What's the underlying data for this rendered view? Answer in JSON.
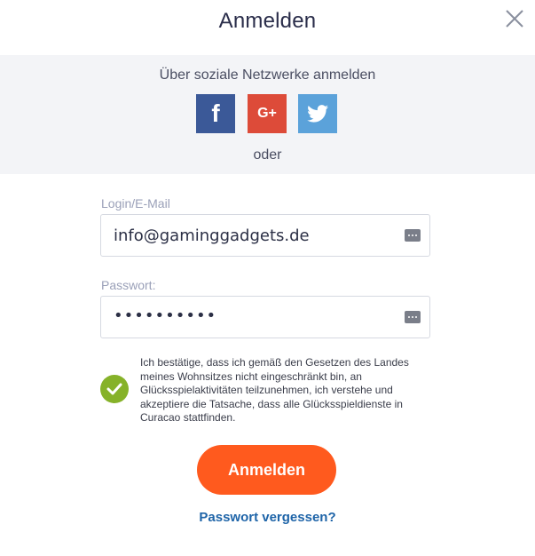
{
  "modal": {
    "title": "Anmelden"
  },
  "social": {
    "title": "Über soziale Netzwerke anmelden",
    "facebook_label": "f",
    "google_label": "G+",
    "separator": "oder",
    "colors": {
      "facebook": "#3b5998",
      "google": "#dd4b39",
      "twitter": "#5ba2da"
    }
  },
  "form": {
    "login_label": "Login/E-Mail",
    "login_value": "info@gaminggadgets.de",
    "password_label": "Passwort:",
    "password_value": "••••••••••",
    "consent_text": "Ich bestätige, dass ich gemäß den Gesetzen des Landes meines Wohnsitzes nicht eingeschränkt bin, an Glücksspielaktivitäten teilzunehmen, ich verstehe und akzeptiere die Tatsache, dass alle Glücksspieldienste in Curacao stattfinden.",
    "consent_checked": true,
    "submit_label": "Anmelden",
    "forgot_label": "Passwort vergessen?"
  },
  "icons": {
    "close": "close-icon",
    "facebook": "facebook-icon",
    "google": "google-plus-icon",
    "twitter": "twitter-icon",
    "password_manager": "password-manager-icon",
    "checkmark": "checkmark-icon"
  },
  "theme": {
    "accent": "#ff5a1e",
    "check": "#86b229",
    "link": "#1e64a8"
  }
}
